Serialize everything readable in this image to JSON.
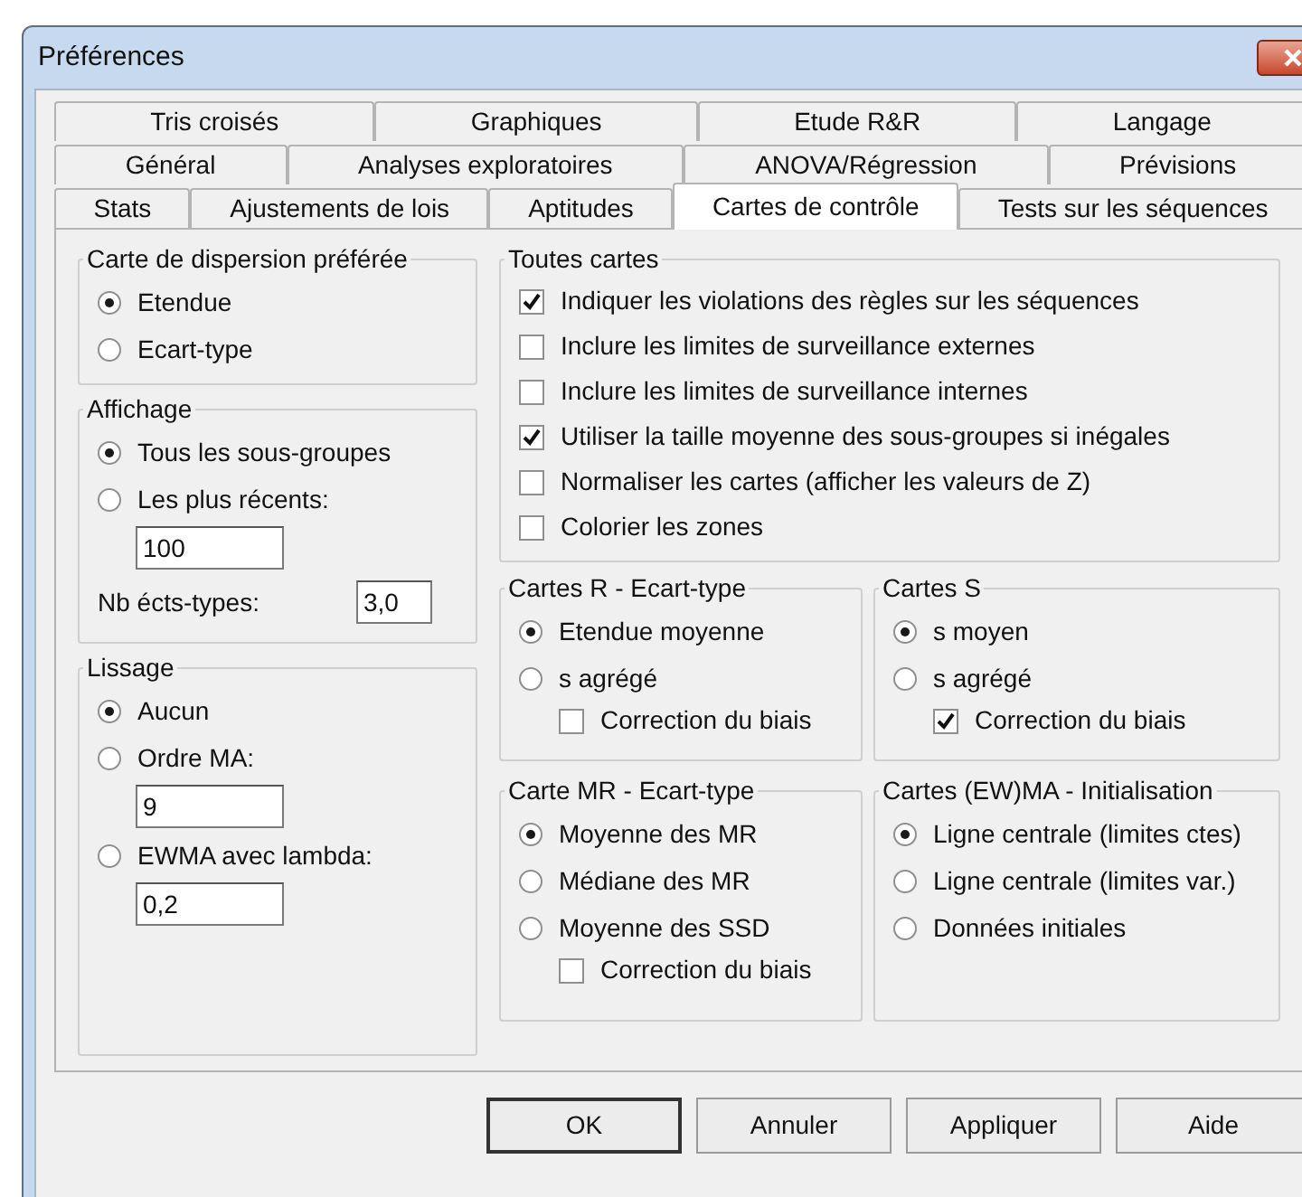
{
  "window": {
    "title": "Préférences"
  },
  "tab_rows": [
    [
      {
        "label": "Tris croisés",
        "selected": false
      },
      {
        "label": "Graphiques",
        "selected": false
      },
      {
        "label": "Etude R&R",
        "selected": false
      },
      {
        "label": "Langage",
        "selected": false
      }
    ],
    [
      {
        "label": "Général",
        "selected": false
      },
      {
        "label": "Analyses exploratoires",
        "selected": false
      },
      {
        "label": "ANOVA/Régression",
        "selected": false
      },
      {
        "label": "Prévisions",
        "selected": false
      }
    ],
    [
      {
        "label": "Stats",
        "selected": false
      },
      {
        "label": "Ajustements de lois",
        "selected": false
      },
      {
        "label": "Aptitudes",
        "selected": false
      },
      {
        "label": "Cartes de contrôle",
        "selected": true
      },
      {
        "label": "Tests sur les séquences",
        "selected": false
      }
    ]
  ],
  "left_groups": [
    {
      "title": "Carte de dispersion préférée",
      "items": [
        {
          "kind": "radio",
          "label": "Etendue",
          "selected": true
        },
        {
          "kind": "radio",
          "label": "Ecart-type",
          "selected": false
        }
      ]
    },
    {
      "title": "Affichage",
      "items": [
        {
          "kind": "radio",
          "label": "Tous les sous-groupes",
          "selected": true
        },
        {
          "kind": "radio",
          "label": "Les plus récents:",
          "selected": false
        },
        {
          "kind": "field",
          "value": "100"
        },
        {
          "kind": "labeled-field",
          "label": "Nb écts-types:",
          "value": "3,0"
        }
      ]
    },
    {
      "title": "Lissage",
      "items": [
        {
          "kind": "radio",
          "label": "Aucun",
          "selected": true
        },
        {
          "kind": "radio",
          "label": "Ordre MA:",
          "selected": false
        },
        {
          "kind": "field",
          "value": "9"
        },
        {
          "kind": "radio",
          "label": "EWMA avec lambda:",
          "selected": false
        },
        {
          "kind": "field",
          "value": "0,2"
        }
      ]
    }
  ],
  "all_charts": {
    "title": "Toutes cartes",
    "items": [
      {
        "kind": "checkbox",
        "label": "Indiquer les violations des règles sur les séquences",
        "checked": true
      },
      {
        "kind": "checkbox",
        "label": "Inclure les limites de surveillance externes",
        "checked": false
      },
      {
        "kind": "checkbox",
        "label": "Inclure les limites de surveillance internes",
        "checked": false
      },
      {
        "kind": "checkbox",
        "label": "Utiliser la taille moyenne des sous-groupes si inégales",
        "checked": true
      },
      {
        "kind": "checkbox",
        "label": "Normaliser les cartes (afficher les valeurs de Z)",
        "checked": false
      },
      {
        "kind": "checkbox",
        "label": "Colorier les zones",
        "checked": false
      }
    ]
  },
  "right_groups": [
    {
      "title": "Cartes R - Ecart-type",
      "items": [
        {
          "kind": "radio",
          "label": "Etendue moyenne",
          "selected": true
        },
        {
          "kind": "radio",
          "label": "s agrégé",
          "selected": false,
          "children": [
            {
              "kind": "checkbox",
              "label": "Correction du biais",
              "checked": false
            }
          ]
        }
      ]
    },
    {
      "title": "Cartes S",
      "items": [
        {
          "kind": "radio",
          "label": "s moyen",
          "selected": true
        },
        {
          "kind": "radio",
          "label": "s agrégé",
          "selected": false,
          "children": [
            {
              "kind": "checkbox",
              "label": "Correction du biais",
              "checked": true
            }
          ]
        }
      ]
    },
    {
      "title": "Carte MR - Ecart-type",
      "items": [
        {
          "kind": "radio",
          "label": "Moyenne des MR",
          "selected": true
        },
        {
          "kind": "radio",
          "label": "Médiane des MR",
          "selected": false
        },
        {
          "kind": "radio",
          "label": "Moyenne des SSD",
          "selected": false,
          "children": [
            {
              "kind": "checkbox",
              "label": "Correction du biais",
              "checked": false
            }
          ]
        }
      ]
    },
    {
      "title": "Cartes (EW)MA - Initialisation",
      "items": [
        {
          "kind": "radio",
          "label": "Ligne centrale (limites ctes)",
          "selected": true
        },
        {
          "kind": "radio",
          "label": "Ligne centrale (limites var.)",
          "selected": false
        },
        {
          "kind": "radio",
          "label": "Données initiales",
          "selected": false
        }
      ]
    }
  ],
  "buttons": [
    {
      "label": "OK",
      "default": true
    },
    {
      "label": "Annuler",
      "default": false
    },
    {
      "label": "Appliquer",
      "default": false
    },
    {
      "label": "Aide",
      "default": false
    }
  ]
}
